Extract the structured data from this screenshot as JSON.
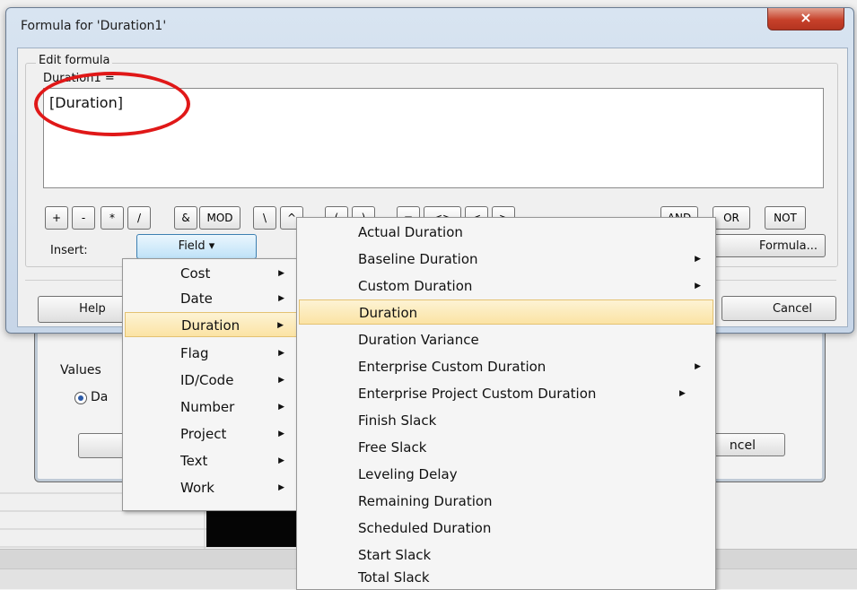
{
  "window": {
    "title": "Formula for 'Duration1'",
    "close_glyph": "×"
  },
  "edit_formula": {
    "group_label": "Edit formula",
    "field_label": "Duration1 =",
    "formula_value": "[Duration]"
  },
  "operators": [
    "+",
    "-",
    "*",
    "/",
    "&",
    "MOD",
    "\\",
    "^",
    "(",
    ")",
    "=",
    "<>",
    "<",
    ">",
    "AND",
    "OR",
    "NOT"
  ],
  "insert": {
    "label": "Insert:",
    "field_button": "Field ▾",
    "formula_button": "Formula..."
  },
  "footer": {
    "help": "Help",
    "cancel": "Cancel"
  },
  "field_menu": {
    "items": [
      {
        "label": "Cost",
        "submenu": true
      },
      {
        "label": "Date",
        "submenu": true
      },
      {
        "label": "Duration",
        "submenu": true,
        "active": true
      },
      {
        "label": "Flag",
        "submenu": true
      },
      {
        "label": "ID/Code",
        "submenu": true
      },
      {
        "label": "Number",
        "submenu": true
      },
      {
        "label": "Project",
        "submenu": true
      },
      {
        "label": "Text",
        "submenu": true
      },
      {
        "label": "Work",
        "submenu": true
      }
    ]
  },
  "duration_menu": {
    "items": [
      {
        "label": "Actual Duration",
        "submenu": false
      },
      {
        "label": "Baseline Duration",
        "submenu": true
      },
      {
        "label": "Custom Duration",
        "submenu": true
      },
      {
        "label": "Duration",
        "submenu": false,
        "active": true
      },
      {
        "label": "Duration Variance",
        "submenu": false
      },
      {
        "label": "Enterprise Custom Duration",
        "submenu": true
      },
      {
        "label": "Enterprise Project Custom Duration",
        "submenu": true
      },
      {
        "label": "Finish Slack",
        "submenu": false
      },
      {
        "label": "Free Slack",
        "submenu": false
      },
      {
        "label": "Leveling Delay",
        "submenu": false
      },
      {
        "label": "Remaining Duration",
        "submenu": false
      },
      {
        "label": "Scheduled Duration",
        "submenu": false
      },
      {
        "label": "Start Slack",
        "submenu": false
      },
      {
        "label": "Total Slack",
        "submenu": false
      }
    ]
  },
  "underlying_dialog": {
    "values_label": "Values",
    "radio_label": "Da",
    "right_button": "ncel"
  },
  "colors": {
    "highlight": "#fbe3a4",
    "annotation_circle": "#e01818",
    "close_button": "#c7412a"
  }
}
